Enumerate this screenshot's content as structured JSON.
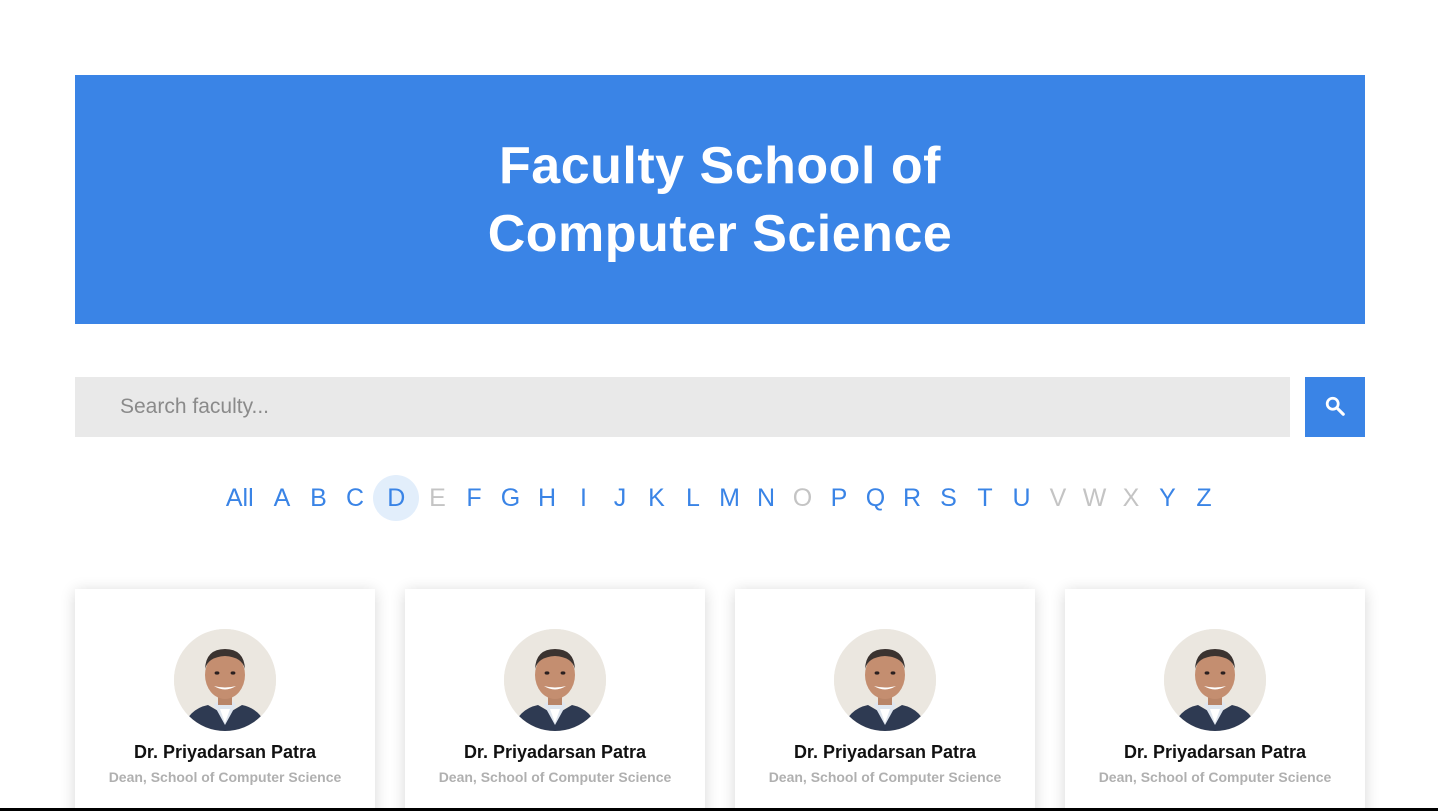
{
  "hero": {
    "title_line1": "Faculty School of",
    "title_line2": "Computer Science",
    "background": "#3a84e6"
  },
  "search": {
    "placeholder": "Search faculty...",
    "value": "",
    "button_icon": "search-icon"
  },
  "alphabet": {
    "active": "D",
    "items": [
      {
        "label": "All",
        "enabled": true
      },
      {
        "label": "A",
        "enabled": true
      },
      {
        "label": "B",
        "enabled": true
      },
      {
        "label": "C",
        "enabled": true
      },
      {
        "label": "D",
        "enabled": true
      },
      {
        "label": "E",
        "enabled": false
      },
      {
        "label": "F",
        "enabled": true
      },
      {
        "label": "G",
        "enabled": true
      },
      {
        "label": "H",
        "enabled": true
      },
      {
        "label": "I",
        "enabled": true
      },
      {
        "label": "J",
        "enabled": true
      },
      {
        "label": "K",
        "enabled": true
      },
      {
        "label": "L",
        "enabled": true
      },
      {
        "label": "M",
        "enabled": true
      },
      {
        "label": "N",
        "enabled": true
      },
      {
        "label": "O",
        "enabled": false
      },
      {
        "label": "P",
        "enabled": true
      },
      {
        "label": "Q",
        "enabled": true
      },
      {
        "label": "R",
        "enabled": true
      },
      {
        "label": "S",
        "enabled": true
      },
      {
        "label": "T",
        "enabled": true
      },
      {
        "label": "U",
        "enabled": true
      },
      {
        "label": "V",
        "enabled": false
      },
      {
        "label": "W",
        "enabled": false
      },
      {
        "label": "X",
        "enabled": false
      },
      {
        "label": "Y",
        "enabled": true
      },
      {
        "label": "Z",
        "enabled": true
      }
    ]
  },
  "faculty": [
    {
      "name": "Dr. Priyadarsan Patra",
      "role": "Dean, School of Computer Science"
    },
    {
      "name": "Dr. Priyadarsan Patra",
      "role": "Dean, School of Computer Science"
    },
    {
      "name": "Dr. Priyadarsan Patra",
      "role": "Dean, School of Computer Science"
    },
    {
      "name": "Dr. Priyadarsan Patra",
      "role": "Dean, School of Computer Science"
    }
  ],
  "colors": {
    "accent": "#3a84e6",
    "disabled_letter": "#c4c4c4",
    "active_letter_bg": "#e2eefb",
    "search_bg": "#e9e9e9"
  }
}
